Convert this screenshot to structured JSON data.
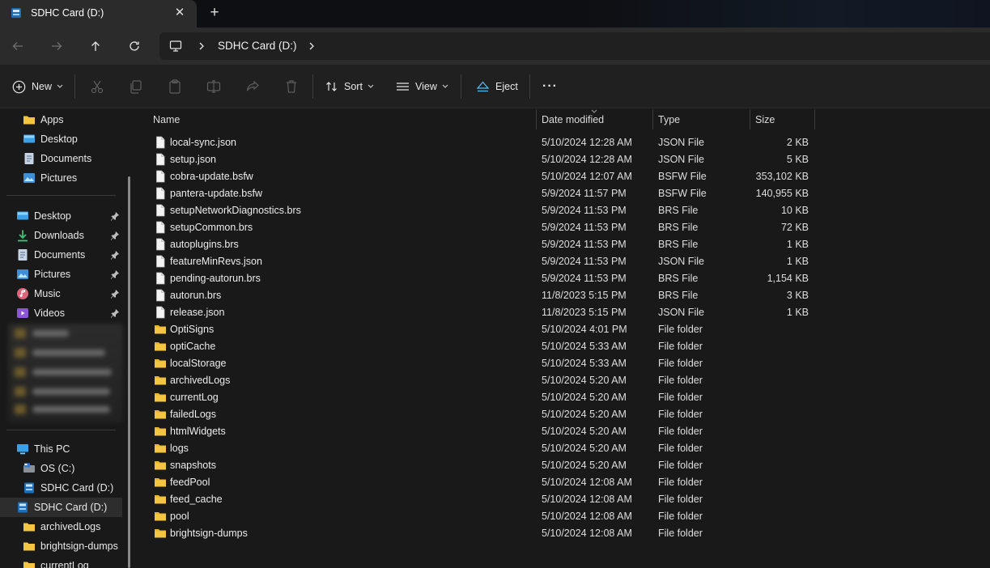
{
  "window": {
    "tab_title": "SDHC Card (D:)",
    "close_glyph": "✕",
    "new_tab_glyph": "+"
  },
  "address": {
    "crumb": "SDHC Card (D:)"
  },
  "toolbar": {
    "new_label": "New",
    "sort_label": "Sort",
    "view_label": "View",
    "eject_label": "Eject",
    "more_glyph": "···"
  },
  "sidebar": {
    "top_items": [
      {
        "label": "Apps",
        "icon": "folder-icon"
      },
      {
        "label": "Desktop",
        "icon": "desktop-icon"
      },
      {
        "label": "Documents",
        "icon": "documents-icon"
      },
      {
        "label": "Pictures",
        "icon": "pictures-icon"
      }
    ],
    "quick_access": [
      {
        "label": "Desktop",
        "icon": "desktop-icon"
      },
      {
        "label": "Downloads",
        "icon": "downloads-icon"
      },
      {
        "label": "Documents",
        "icon": "documents-icon"
      },
      {
        "label": "Pictures",
        "icon": "pictures-icon"
      },
      {
        "label": "Music",
        "icon": "music-icon"
      },
      {
        "label": "Videos",
        "icon": "videos-icon"
      }
    ],
    "this_pc": {
      "label": "This PC",
      "icon": "this-pc-icon"
    },
    "drives": [
      {
        "label": "OS (C:)",
        "icon": "os-drive-icon"
      },
      {
        "label": "SDHC Card (D:)",
        "icon": "sd-card-icon"
      }
    ],
    "sd_card": {
      "label": "SDHC Card (D:)",
      "icon": "sd-card-icon"
    },
    "sd_children": [
      {
        "label": "archivedLogs"
      },
      {
        "label": "brightsign-dumps"
      },
      {
        "label": "currentLog"
      }
    ]
  },
  "columns": {
    "name": "Name",
    "date": "Date modified",
    "type": "Type",
    "size": "Size"
  },
  "files": [
    {
      "name": "local-sync.json",
      "date": "5/10/2024 12:28 AM",
      "type": "JSON File",
      "size": "2 KB",
      "kind": "file"
    },
    {
      "name": "setup.json",
      "date": "5/10/2024 12:28 AM",
      "type": "JSON File",
      "size": "5 KB",
      "kind": "file"
    },
    {
      "name": "cobra-update.bsfw",
      "date": "5/10/2024 12:07 AM",
      "type": "BSFW File",
      "size": "353,102 KB",
      "kind": "file"
    },
    {
      "name": "pantera-update.bsfw",
      "date": "5/9/2024 11:57 PM",
      "type": "BSFW File",
      "size": "140,955 KB",
      "kind": "file"
    },
    {
      "name": "setupNetworkDiagnostics.brs",
      "date": "5/9/2024 11:53 PM",
      "type": "BRS File",
      "size": "10 KB",
      "kind": "file"
    },
    {
      "name": "setupCommon.brs",
      "date": "5/9/2024 11:53 PM",
      "type": "BRS File",
      "size": "72 KB",
      "kind": "file"
    },
    {
      "name": "autoplugins.brs",
      "date": "5/9/2024 11:53 PM",
      "type": "BRS File",
      "size": "1 KB",
      "kind": "file"
    },
    {
      "name": "featureMinRevs.json",
      "date": "5/9/2024 11:53 PM",
      "type": "JSON File",
      "size": "1 KB",
      "kind": "file"
    },
    {
      "name": "pending-autorun.brs",
      "date": "5/9/2024 11:53 PM",
      "type": "BRS File",
      "size": "1,154 KB",
      "kind": "file"
    },
    {
      "name": "autorun.brs",
      "date": "11/8/2023 5:15 PM",
      "type": "BRS File",
      "size": "3 KB",
      "kind": "file"
    },
    {
      "name": "release.json",
      "date": "11/8/2023 5:15 PM",
      "type": "JSON File",
      "size": "1 KB",
      "kind": "file"
    },
    {
      "name": "OptiSigns",
      "date": "5/10/2024 4:01 PM",
      "type": "File folder",
      "size": "",
      "kind": "folder"
    },
    {
      "name": "optiCache",
      "date": "5/10/2024 5:33 AM",
      "type": "File folder",
      "size": "",
      "kind": "folder"
    },
    {
      "name": "localStorage",
      "date": "5/10/2024 5:33 AM",
      "type": "File folder",
      "size": "",
      "kind": "folder"
    },
    {
      "name": "archivedLogs",
      "date": "5/10/2024 5:20 AM",
      "type": "File folder",
      "size": "",
      "kind": "folder"
    },
    {
      "name": "currentLog",
      "date": "5/10/2024 5:20 AM",
      "type": "File folder",
      "size": "",
      "kind": "folder"
    },
    {
      "name": "failedLogs",
      "date": "5/10/2024 5:20 AM",
      "type": "File folder",
      "size": "",
      "kind": "folder"
    },
    {
      "name": "htmlWidgets",
      "date": "5/10/2024 5:20 AM",
      "type": "File folder",
      "size": "",
      "kind": "folder"
    },
    {
      "name": "logs",
      "date": "5/10/2024 5:20 AM",
      "type": "File folder",
      "size": "",
      "kind": "folder"
    },
    {
      "name": "snapshots",
      "date": "5/10/2024 5:20 AM",
      "type": "File folder",
      "size": "",
      "kind": "folder"
    },
    {
      "name": "feedPool",
      "date": "5/10/2024 12:08 AM",
      "type": "File folder",
      "size": "",
      "kind": "folder"
    },
    {
      "name": "feed_cache",
      "date": "5/10/2024 12:08 AM",
      "type": "File folder",
      "size": "",
      "kind": "folder"
    },
    {
      "name": "pool",
      "date": "5/10/2024 12:08 AM",
      "type": "File folder",
      "size": "",
      "kind": "folder"
    },
    {
      "name": "brightsign-dumps",
      "date": "5/10/2024 12:08 AM",
      "type": "File folder",
      "size": "",
      "kind": "folder"
    }
  ],
  "colors": {
    "folder": "#f4c542",
    "accent": "#4cc2ff",
    "background": "#191919"
  }
}
